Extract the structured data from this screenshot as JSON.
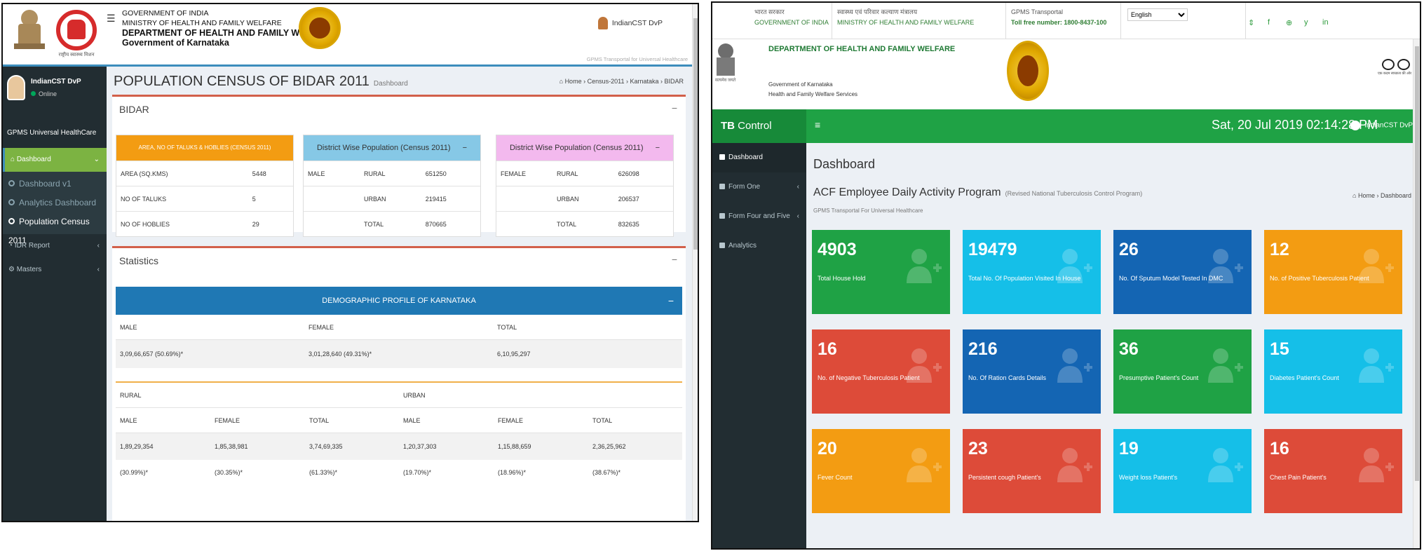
{
  "left": {
    "header": {
      "gov_line1": "GOVERNMENT OF INDIA",
      "gov_line2": "MINISTRY OF HEALTH AND FAMILY WELFARE",
      "dept": "DEPARTMENT OF HEALTH AND FAMILY WELFARE",
      "state": "Government of Karnataka",
      "user": "IndianCST DvP",
      "tagline": "GPMS Transportal for Universal Healthcare",
      "nhm_caption": "राष्ट्रीय स्वास्थ्य मिशन",
      "menu_icon": "☰"
    },
    "sidebar": {
      "user_name": "IndianCST DvP",
      "status": "Online",
      "brand": "GPMS Universal HealthCare",
      "menu": [
        {
          "label": "Dashboard",
          "icon": "dashboard-icon"
        },
        {
          "label": "IDR Report",
          "icon": "pie-chart-icon"
        },
        {
          "label": "Masters",
          "icon": "gear-icon"
        }
      ],
      "sub": [
        "Dashboard v1",
        "Analytics Dashboard",
        "Population Census 2011"
      ]
    },
    "page": {
      "title": "POPULATION CENSUS OF BIDAR 2011",
      "subtitle": "Dashboard",
      "breadcrumb": [
        "Home",
        "Census-2011",
        "Karnataka",
        "BIDAR"
      ]
    },
    "bidar_box": {
      "title": "BIDAR",
      "area_card": {
        "header": "AREA, NO OF TALUKS & HOBLIES (CENSUS 2011)",
        "rows": [
          [
            "AREA (SQ.KMS)",
            "5448"
          ],
          [
            "NO OF TALUKS",
            "5"
          ],
          [
            "NO OF HOBLIES",
            "29"
          ]
        ]
      },
      "male_card": {
        "header": "District Wise Population (Census 2011)",
        "label": "MALE",
        "rows": [
          [
            "RURAL",
            "651250"
          ],
          [
            "URBAN",
            "219415"
          ],
          [
            "TOTAL",
            "870665"
          ]
        ]
      },
      "female_card": {
        "header": "District Wise Population (Census 2011)",
        "label": "FEMALE",
        "rows": [
          [
            "RURAL",
            "626098"
          ],
          [
            "URBAN",
            "206537"
          ],
          [
            "TOTAL",
            "832635"
          ]
        ]
      }
    },
    "stats_box": {
      "title": "Statistics",
      "demo_header": "DEMOGRAPHIC PROFILE OF KARNATAKA",
      "cols": [
        "MALE",
        "FEMALE",
        "TOTAL"
      ],
      "vals": [
        "3,09,66,657 (50.69%)*",
        "3,01,28,640 (49.31%)*",
        "6,10,95,297"
      ],
      "rural": "RURAL",
      "urban": "URBAN",
      "sub_cols": [
        "MALE",
        "FEMALE",
        "TOTAL",
        "MALE",
        "FEMALE",
        "TOTAL"
      ],
      "sub_vals": [
        "1,89,29,354",
        "1,85,38,981",
        "3,74,69,335",
        "1,20,37,303",
        "1,15,88,659",
        "2,36,25,962"
      ],
      "sub_pct": [
        "(30.99%)*",
        "(30.35%)*",
        "(61.33%)*",
        "(19.70%)*",
        "(18.96%)*",
        "(38.67%)*"
      ]
    },
    "collapse_icon": "−"
  },
  "right": {
    "top": {
      "col1a": "भारत सरकार",
      "col1b": "GOVERNMENT OF INDIA",
      "col2a": "स्वास्थ्य एवं परिवार कल्याण मंत्रालय",
      "col2b": "MINISTRY OF HEALTH AND FAMILY WELFARE",
      "col3a": "GPMS Transportal",
      "col3b": "Toll free number: 1800-8437-100",
      "language": "English",
      "social": [
        "⇕",
        "f",
        "⊕",
        "y",
        "in"
      ]
    },
    "banner": {
      "dept": "DEPARTMENT OF HEALTH AND FAMILY WELFARE",
      "sub1": "Government of Karnataka",
      "sub2": "Health and Family Welfare Services",
      "emblem_caption": "सत्यमेव जयते",
      "swachh_caption": "एक कदम स्वच्छता की ओर"
    },
    "nav": {
      "brand_bold": "TB",
      "brand_rest": " Control Program",
      "datetime": "Sat, 20 Jul 2019  02:14:28 PM",
      "user": "IndianCST DvP",
      "menu_icon": "≡"
    },
    "sidebar": [
      {
        "label": "Dashboard",
        "chev": false
      },
      {
        "label": "Form One",
        "chev": true
      },
      {
        "label": "Form Four and Five",
        "chev": true
      },
      {
        "label": "Analytics",
        "chev": false
      }
    ],
    "content": {
      "title": "Dashboard",
      "heading": "ACF Employee Daily Activity Program",
      "heading_sub": "(Revised National Tuberculosis Control Program)",
      "caption": "GPMS Transportal For Universal Healthcare",
      "breadcrumb": [
        "Home",
        "Dashboard"
      ]
    },
    "tiles": [
      {
        "value": "4903",
        "label": "Total House Hold",
        "color": "#1fa245",
        "icon": "home-icon"
      },
      {
        "value": "19479",
        "label": "Total No. Of Population Visited In House",
        "color": "#15bfe8",
        "icon": "add-user-icon"
      },
      {
        "value": "26",
        "label": "No. Of Sputum Model Tested In DMC",
        "color": "#1465b3",
        "icon": "pie-chart-icon"
      },
      {
        "value": "12",
        "label": "No. of Positive Tuberculosis Patient",
        "color": "#f39c12",
        "icon": "bolt-icon"
      },
      {
        "value": "16",
        "label": "No. of Negative Tuberculosis Patient",
        "color": "#dd4b39",
        "icon": "hospital-icon"
      },
      {
        "value": "216",
        "label": "No. Of Ration Cards Details",
        "color": "#1465b3",
        "icon": "user-icon"
      },
      {
        "value": "36",
        "label": "Presumptive Patient's Count",
        "color": "#1fa245",
        "icon": "hospital-icon"
      },
      {
        "value": "15",
        "label": "Diabetes Patient's Count",
        "color": "#15bfe8",
        "icon": "hospital-icon"
      },
      {
        "value": "20",
        "label": "Fever Count",
        "color": "#f39c12",
        "icon": "users-icon"
      },
      {
        "value": "23",
        "label": "Persistent cough Patient's",
        "color": "#dd4b39",
        "icon": "add-user-icon"
      },
      {
        "value": "19",
        "label": "Weight loss Patient's",
        "color": "#15bfe8",
        "icon": "add-user-icon"
      },
      {
        "value": "16",
        "label": "Chest Pain Patient's",
        "color": "#dd4b39",
        "icon": "add-user-icon"
      }
    ]
  }
}
